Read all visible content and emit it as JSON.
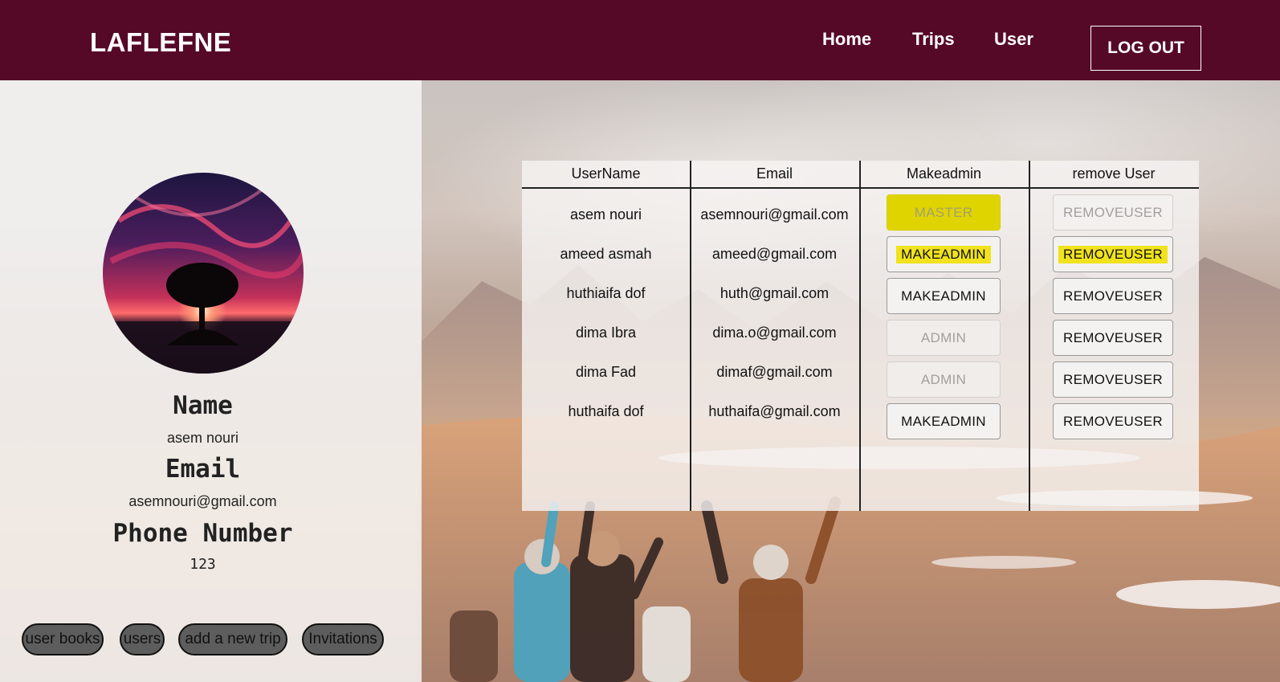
{
  "navbar": {
    "brand": "LAFLEFNE",
    "links": [
      "Home",
      "Trips",
      "User"
    ],
    "logout_label": "LOG OUT"
  },
  "profile": {
    "name_heading": "Name",
    "name_value": "asem nouri",
    "email_heading": "Email",
    "email_value": "asemnouri@gmail.com",
    "phone_heading": "Phone Number",
    "phone_value": "123",
    "buttons": [
      "user books",
      "users",
      "add a new trip",
      "Invitations"
    ]
  },
  "users_table": {
    "headers": [
      "UserName",
      "Email",
      "Makeadmin",
      "remove User"
    ],
    "rows": [
      {
        "username": "asem nouri",
        "email": "asemnouri@gmail.com",
        "admin_action": "MASTER",
        "remove_action": "REMOVEUSER"
      },
      {
        "username": "ameed asmah",
        "email": "ameed@gmail.com",
        "admin_action": "MAKEADMIN",
        "remove_action": "REMOVEUSER"
      },
      {
        "username": "huthiaifa dof",
        "email": "huth@gmail.com",
        "admin_action": "MAKEADMIN",
        "remove_action": "REMOVEUSER"
      },
      {
        "username": "dima Ibra",
        "email": "dima.o@gmail.com",
        "admin_action": "ADMIN",
        "remove_action": "REMOVEUSER"
      },
      {
        "username": "dima Fad",
        "email": "dimaf@gmail.com",
        "admin_action": "ADMIN",
        "remove_action": "REMOVEUSER"
      },
      {
        "username": "huthaifa dof",
        "email": "huthaifa@gmail.com",
        "admin_action": "MAKEADMIN",
        "remove_action": "REMOVEUSER"
      }
    ]
  },
  "colors": {
    "navbar": "#550927",
    "highlight": "#f0e21c",
    "master_button": "#e0d400"
  }
}
